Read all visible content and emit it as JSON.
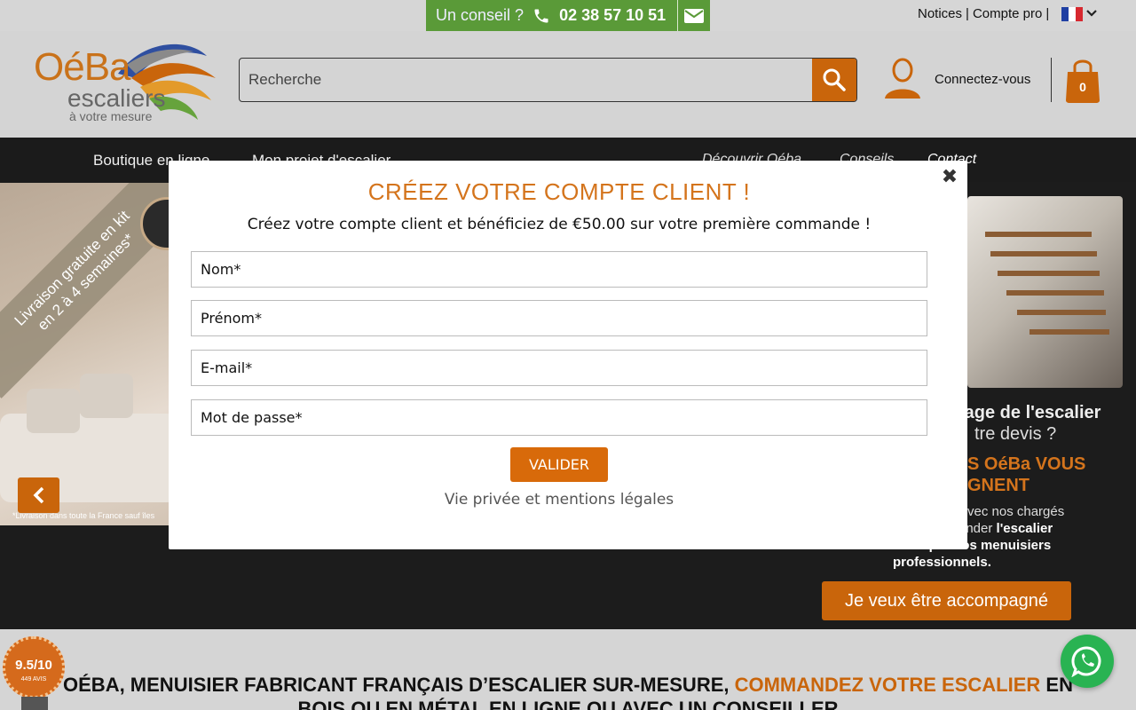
{
  "topbar": {
    "conseil_label": "Un conseil ?",
    "phone": "02 38 57 10 51",
    "links": [
      "Notices",
      "|",
      "Compte pro",
      "|"
    ],
    "language_flag": "fr-flag",
    "colors": {
      "conseil_bg": "#5a9a38",
      "accent": "#c9650b"
    }
  },
  "header": {
    "logo_main": "OéBa",
    "logo_sub": "escaliers",
    "logo_tagline": "à votre mesure",
    "search_placeholder": "Recherche",
    "connect_label": "Connectez-vous",
    "cart_count": "0"
  },
  "nav": {
    "items": [
      "Boutique en ligne",
      "Mon projet d'escalier",
      "Découvrir Oéba",
      "Conseils",
      "Contact"
    ]
  },
  "hero": {
    "left_band": "Livraison gratuite en kit\nen 2 à 4 semaines*",
    "left_footnote": "*Livraison dans toute la France sauf îles",
    "right_line1": "tage de l'escalier",
    "right_line2": "tre devis ?",
    "right_line3": "S OéBa VOUS",
    "right_line4": "GNENT",
    "right_line5": "vec nos chargés",
    "right_line6a": "ander ",
    "right_line6b": "l'escalier",
    "right_line7": "avec l'installation par nos menuisiers",
    "right_line8": "professionnels.",
    "cta": "Je veux être accompagné"
  },
  "bottom": {
    "badge_score": "9.5/10",
    "badge_avis": "449 AVIS",
    "headline_a": "OÉBA, MENUISIER FABRICANT FRANÇAIS D’ESCALIER SUR-MESURE, ",
    "headline_b": "COMMANDEZ VOTRE ESCALIER",
    "headline_c": " EN",
    "headline_line2": "BOIS OU EN MÉTAL EN LIGNE OU AVEC UN CONSEILLER"
  },
  "modal": {
    "title": "CRÉEZ VOTRE COMPTE CLIENT !",
    "subtitle": "Créez votre compte client et bénéficiez de €50.00 sur votre première commande !",
    "fields": {
      "nom": "Nom*",
      "prenom": "Prénom*",
      "email": "E-mail*",
      "password": "Mot de passe*"
    },
    "submit": "VALIDER",
    "legal": "Vie privée et mentions légales",
    "close_glyph": "✖"
  }
}
